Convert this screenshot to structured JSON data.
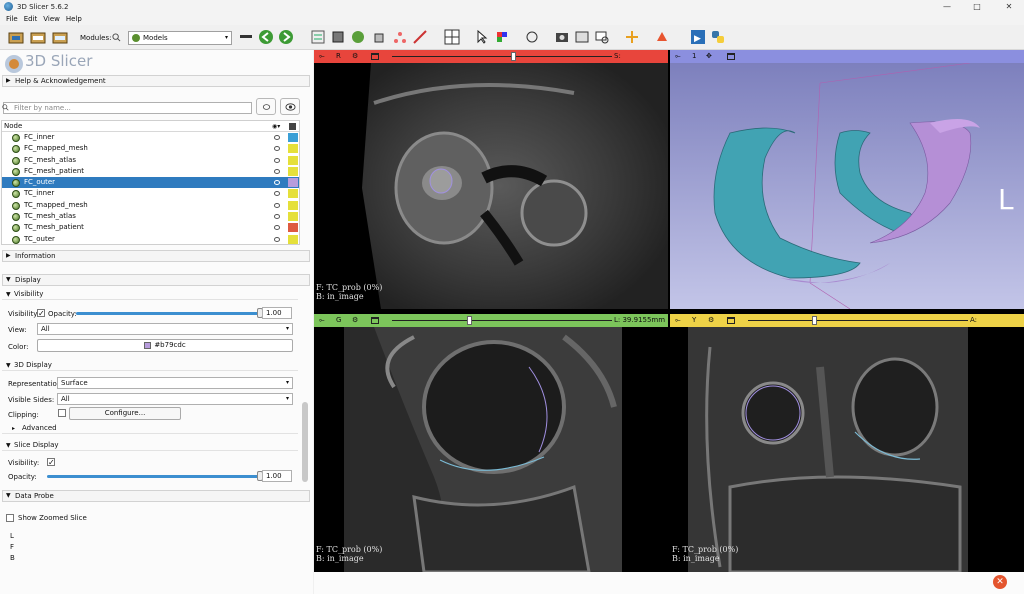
{
  "window": {
    "title": "3D Slicer 5.6.2",
    "minimize": "—",
    "maximize": "□",
    "close": "✕"
  },
  "menu": [
    "File",
    "Edit",
    "View",
    "Help"
  ],
  "toolbar": {
    "modules_label": "Modules:",
    "module_selected": "Models"
  },
  "left": {
    "logo_text": "3D Slicer",
    "help_section": "Help & Acknowledgement",
    "filter_placeholder": "Filter by name...",
    "tree_header": "Node",
    "nodes": [
      {
        "name": "FC_inner",
        "color": "#3a9fd6",
        "selected": false
      },
      {
        "name": "FC_mapped_mesh",
        "color": "#e5e03a",
        "selected": false
      },
      {
        "name": "FC_mesh_atlas",
        "color": "#e5e03a",
        "selected": false
      },
      {
        "name": "FC_mesh_patient",
        "color": "#e5e03a",
        "selected": false
      },
      {
        "name": "FC_outer",
        "color": "#b79cdc",
        "selected": true
      },
      {
        "name": "TC_inner",
        "color": "#e5e03a",
        "selected": false
      },
      {
        "name": "TC_mapped_mesh",
        "color": "#e5e03a",
        "selected": false
      },
      {
        "name": "TC_mesh_atlas",
        "color": "#e5e03a",
        "selected": false
      },
      {
        "name": "TC_mesh_patient",
        "color": "#de5a40",
        "selected": false
      },
      {
        "name": "TC_outer",
        "color": "#e5e03a",
        "selected": false
      }
    ],
    "information": "Information",
    "display": "Display",
    "visibility_sub": "Visibility",
    "visibility_label": "Visibility:",
    "opacity_label": "Opacity:",
    "opacity_value": "1.00",
    "opacity_fraction": 1.0,
    "view_label": "View:",
    "view_value": "All",
    "color_label": "Color:",
    "color_value": "#b79cdc",
    "display3d": "3D Display",
    "representation_label": "Representation:",
    "representation_value": "Surface",
    "visible_sides_label": "Visible Sides:",
    "visible_sides_value": "All",
    "clipping_label": "Clipping:",
    "configure": "Configure...",
    "advanced": "Advanced",
    "slice_display": "Slice Display",
    "slice_visibility_label": "Visibility:",
    "slice_opacity_label": "Opacity:",
    "slice_opacity_value": "1.00",
    "slice_opacity_fraction": 1.0,
    "data_probe": "Data Probe",
    "show_zoomed": "Show Zoomed Slice",
    "probe_l": "L",
    "probe_f": "F",
    "probe_b": "B"
  },
  "views": {
    "red": {
      "letter": "R",
      "offset": "S: -19.5838mm",
      "slider": 0.55,
      "anno_f": "F: TC_prob (0%)",
      "anno_b": "B: in_image"
    },
    "blue": {
      "letter": "1",
      "orient": "L"
    },
    "green": {
      "letter": "G",
      "offset": "L: 39.9155mm",
      "slider": 0.35,
      "anno_f": "F: TC_prob (0%)",
      "anno_b": "B: in_image"
    },
    "yellow": {
      "letter": "Y",
      "offset": "A: -14.0734mm",
      "slider": 0.3,
      "anno_f": "F: TC_prob (0%)",
      "anno_b": "B: in_image"
    }
  },
  "status": {
    "error_icon": "✕"
  }
}
